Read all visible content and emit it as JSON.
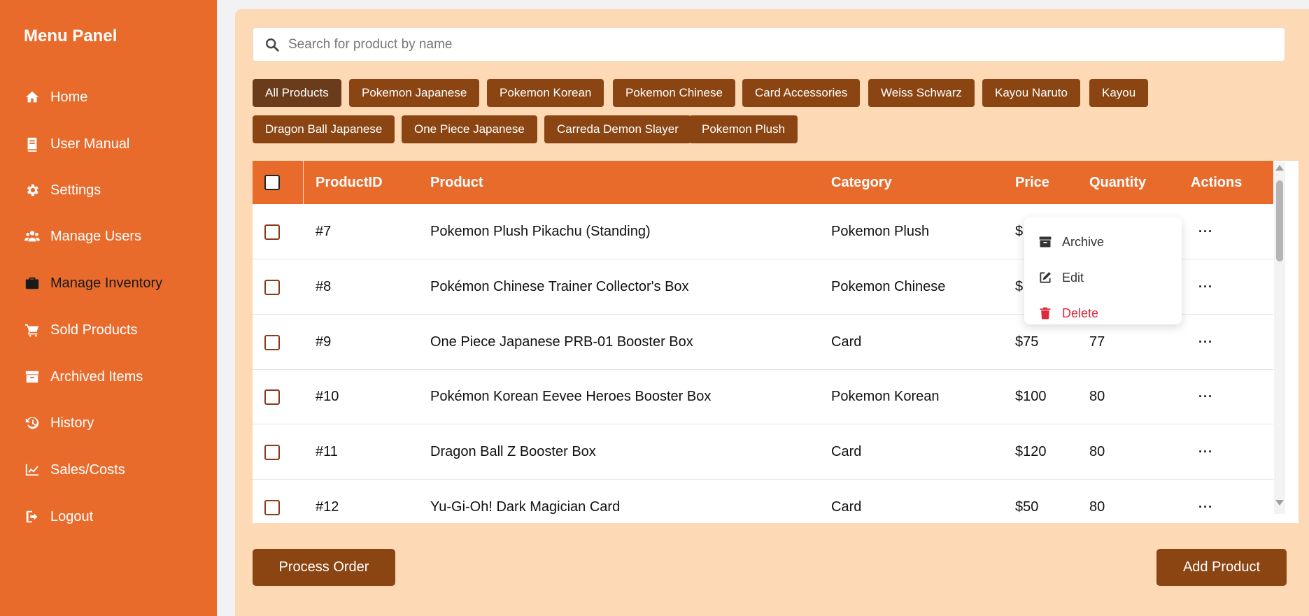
{
  "sidebar": {
    "title": "Menu Panel",
    "items": [
      {
        "label": "Home",
        "icon": "home-icon"
      },
      {
        "label": "User Manual",
        "icon": "book-icon"
      },
      {
        "label": "Settings",
        "icon": "gear-icon"
      },
      {
        "label": "Manage Users",
        "icon": "users-icon"
      },
      {
        "label": "Manage Inventory",
        "icon": "briefcase-icon",
        "active": true
      },
      {
        "label": "Sold Products",
        "icon": "cart-icon"
      },
      {
        "label": "Archived Items",
        "icon": "archive-icon"
      },
      {
        "label": "History",
        "icon": "history-icon"
      },
      {
        "label": "Sales/Costs",
        "icon": "chart-line-icon"
      },
      {
        "label": "Logout",
        "icon": "logout-icon"
      }
    ]
  },
  "search": {
    "placeholder": "Search for product by name"
  },
  "filters": [
    "All Products",
    "Pokemon Japanese",
    "Pokemon Korean",
    "Pokemon Chinese",
    "Card Accessories",
    "Weiss Schwarz",
    "Kayou Naruto",
    "Kayou",
    "Dragon Ball Japanese",
    "One Piece Japanese",
    "Carreda Demon Slayer",
    "Pokemon Plush"
  ],
  "table": {
    "headers": {
      "id": "ProductID",
      "product": "Product",
      "category": "Category",
      "price": "Price",
      "quantity": "Quantity",
      "actions": "Actions"
    },
    "rows": [
      {
        "id": "#7",
        "product": "Pokemon Plush Pikachu (Standing)",
        "category": "Pokemon Plush",
        "price": "$",
        "quantity": ""
      },
      {
        "id": "#8",
        "product": "Pokémon Chinese Trainer Collector's Box",
        "category": "Pokemon Chinese",
        "price": "$",
        "quantity": ""
      },
      {
        "id": "#9",
        "product": "One Piece Japanese PRB-01 Booster Box",
        "category": "Card",
        "price": "$75",
        "quantity": "77"
      },
      {
        "id": "#10",
        "product": "Pokémon Korean Eevee Heroes Booster Box",
        "category": "Pokemon Korean",
        "price": "$100",
        "quantity": "80"
      },
      {
        "id": "#11",
        "product": "Dragon Ball Z Booster Box",
        "category": "Card",
        "price": "$120",
        "quantity": "80"
      },
      {
        "id": "#12",
        "product": "Yu-Gi-Oh! Dark Magician Card",
        "category": "Card",
        "price": "$50",
        "quantity": "80"
      }
    ],
    "row_action": "···"
  },
  "context_menu": {
    "archive": "Archive",
    "edit": "Edit",
    "delete": "Delete"
  },
  "buttons": {
    "process_order": "Process Order",
    "add_product": "Add Product"
  },
  "colors": {
    "sidebar": "#e96b2c",
    "content_bg": "#fdd9b5",
    "button": "#8b4513",
    "danger": "#e0263a"
  }
}
